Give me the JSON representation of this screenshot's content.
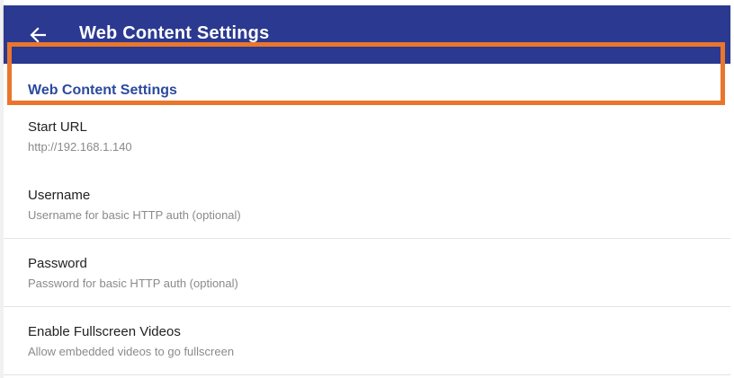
{
  "app_bar": {
    "title": "Web Content Settings",
    "back_icon": "arrow-left-icon",
    "color": "#2b3990"
  },
  "section": {
    "header": "Web Content Settings",
    "header_color": "#2b4aa0"
  },
  "preferences": [
    {
      "title": "Start URL",
      "summary": "http://192.168.1.140"
    },
    {
      "title": "Username",
      "summary": "Username for basic HTTP auth (optional)"
    },
    {
      "title": "Password",
      "summary": "Password for basic HTTP auth (optional)"
    },
    {
      "title": "Enable Fullscreen Videos",
      "summary": "Allow embedded videos to go fullscreen"
    }
  ],
  "highlight": {
    "target": "Start URL",
    "color": "#e9762c"
  }
}
